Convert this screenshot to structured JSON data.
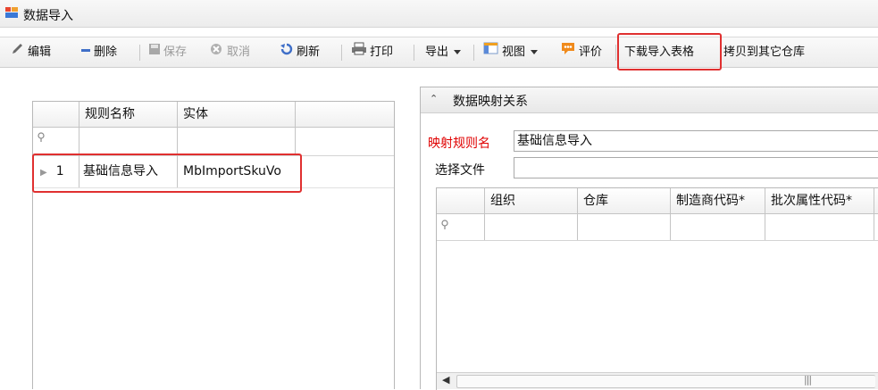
{
  "window": {
    "title": "数据导入"
  },
  "toolbar": {
    "edit": "编辑",
    "delete": "删除",
    "save": "保存",
    "cancel": "取消",
    "refresh": "刷新",
    "print": "打印",
    "export": "导出",
    "view": "视图",
    "rate": "评价",
    "download_template": "下载导入表格",
    "copy_to_other": "拷贝到其它仓库"
  },
  "rules_grid": {
    "columns": [
      "规则名称",
      "实体"
    ],
    "rows": [
      {
        "index": "1",
        "rule_name": "基础信息导入",
        "entity": "MbImportSkuVo"
      }
    ]
  },
  "mapping_panel": {
    "title": "数据映射关系",
    "rule_name_label": "映射规则名",
    "rule_name_value": "基础信息导入",
    "file_label": "选择文件",
    "file_value": "",
    "columns": [
      "组织",
      "仓库",
      "制造商代码*",
      "批次属性代码*"
    ]
  },
  "colors": {
    "highlight": "#e03030",
    "required_label": "#e00000"
  },
  "icons": [
    "app-icon",
    "pencil-icon",
    "minus-icon",
    "save-icon",
    "cancel-icon",
    "refresh-icon",
    "print-icon",
    "dropdown-icon",
    "view-icon",
    "rate-icon",
    "pin-icon",
    "row-indicator-icon",
    "collapse-icon",
    "scroll-left-icon",
    "scroll-grip-icon"
  ]
}
